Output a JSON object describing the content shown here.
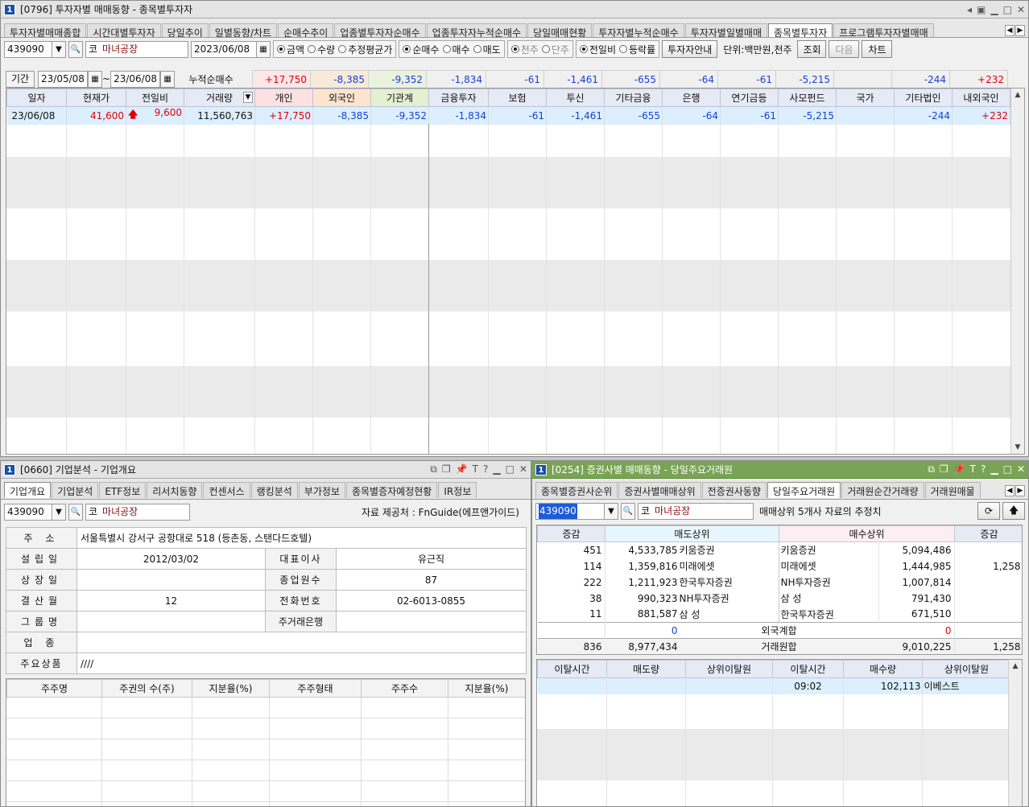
{
  "top": {
    "title": "[0796] 투자자별 매매동향 - 종목별투자자",
    "tabs": [
      "투자자별매매종합",
      "시간대별투자자",
      "당일추이",
      "일별동향/차트",
      "순매수추이",
      "업종별투자자순매수",
      "업종투자자누적순매수",
      "당일매매현황",
      "투자자별누적순매수",
      "투자자별일별매매",
      "종목별투자자",
      "프로그램투자자별매매"
    ],
    "code": "439090",
    "market": "코",
    "name": "마녀공장",
    "date": "2023/06/08",
    "r1": [
      "금액",
      "수량",
      "추정평균가"
    ],
    "r2": [
      "순매수",
      "매수",
      "매도"
    ],
    "r3": [
      "천주",
      "단주"
    ],
    "r4": [
      "전일비",
      "등락률"
    ],
    "guide": "투자자안내",
    "unit": "단위:백만원,천주",
    "btn_search": "조회",
    "btn_next": "다음",
    "btn_chart": "차트",
    "period_label": "기간",
    "from": "23/05/08",
    "tilde": "~",
    "to": "23/06/08",
    "cum_label": "누적순매수",
    "cum": [
      "+17,750",
      "-8,385",
      "-9,352",
      "-1,834",
      "-61",
      "-1,461",
      "-655",
      "-64",
      "-61",
      "-5,215",
      "",
      "-244",
      "+232"
    ],
    "headers": [
      "일자",
      "현재가",
      "전일비",
      "거래량",
      "개인",
      "외국인",
      "기관계",
      "금융투자",
      "보험",
      "투신",
      "기타금융",
      "은행",
      "연기금등",
      "사모펀드",
      "국가",
      "기타법인",
      "내외국인"
    ],
    "row": [
      "23/06/08",
      "41,600",
      "9,600",
      "11,560,763",
      "+17,750",
      "-8,385",
      "-9,352",
      "-1,834",
      "-61",
      "-1,461",
      "-655",
      "-64",
      "-61",
      "-5,215",
      "",
      "-244",
      "+232"
    ]
  },
  "left": {
    "title": "[0660] 기업분석 - 기업개요",
    "tabs": [
      "기업개요",
      "기업분석",
      "ETF정보",
      "리서치동향",
      "컨센서스",
      "랭킹분석",
      "부가정보",
      "종목별증자예정현황",
      "IR정보"
    ],
    "code": "439090",
    "market": "코",
    "name": "마녀공장",
    "source": "자료 제공처 : FnGuide(에프앤가이드)",
    "address_label": "주 소",
    "address": "서울특별시 강서구 공항대로 518 (등촌동, 스탠다드호텔)",
    "est_label": "설립일",
    "est": "2012/03/02",
    "ceo_label": "대표이사",
    "ceo": "유근직",
    "listed_label": "상장일",
    "listed": "",
    "emp_label": "종업원수",
    "emp": "87",
    "fy_label": "결산월",
    "fy": "12",
    "tel_label": "전화번호",
    "tel": "02-6013-0855",
    "group_label": "그룹명",
    "group": "",
    "bank_label": "주거래은행",
    "bank": "",
    "biz_label": "업 종",
    "biz": "",
    "product_label": "주요상품",
    "product": "////",
    "sh_headers": [
      "주주명",
      "주권의 수(주)",
      "지분율(%)",
      "주주형태",
      "주주수",
      "지분율(%)"
    ]
  },
  "right": {
    "title": "[0254] 증권사별 매매동향 - 당일주요거래원",
    "tabs": [
      "종목별증권사순위",
      "증권사별매매상위",
      "전증권사동향",
      "당일주요거래원",
      "거래원순간거래량",
      "거래원매물"
    ],
    "code": "439090",
    "market": "코",
    "name": "마녀공장",
    "note": "매매상위 5개사 자료의 추정치",
    "headers": [
      "증감",
      "매도상위",
      "매수상위",
      "증감"
    ],
    "rows": [
      {
        "sc": "451",
        "sv": "4,533,785",
        "sn": "키움증권",
        "bn": "키움증권",
        "bv": "5,094,486",
        "bc": ""
      },
      {
        "sc": "114",
        "sv": "1,359,816",
        "sn": "미래에셋",
        "bn": "미래에셋",
        "bv": "1,444,985",
        "bc": "1,258"
      },
      {
        "sc": "222",
        "sv": "1,211,923",
        "sn": "한국투자증권",
        "bn": "NH투자증권",
        "bv": "1,007,814",
        "bc": ""
      },
      {
        "sc": "38",
        "sv": "990,323",
        "sn": "NH투자증권",
        "bn": "삼 성",
        "bv": "791,430",
        "bc": ""
      },
      {
        "sc": "11",
        "sv": "881,587",
        "sn": "삼 성",
        "bn": "한국투자증권",
        "bv": "671,510",
        "bc": ""
      }
    ],
    "foreign_label": "외국계합",
    "foreign_sell": "0",
    "foreign_buy": "0",
    "total_label": "거래원합",
    "total_sc": "836",
    "total_sv": "8,977,434",
    "total_bv": "9,010,225",
    "total_bc": "1,258",
    "exit_headers": [
      "이탈시간",
      "매도량",
      "상위이탈원",
      "이탈시간",
      "매수량",
      "상위이탈원"
    ],
    "exit_row": {
      "time": "09:02",
      "qty": "102,113",
      "broker": "이베스트"
    }
  }
}
